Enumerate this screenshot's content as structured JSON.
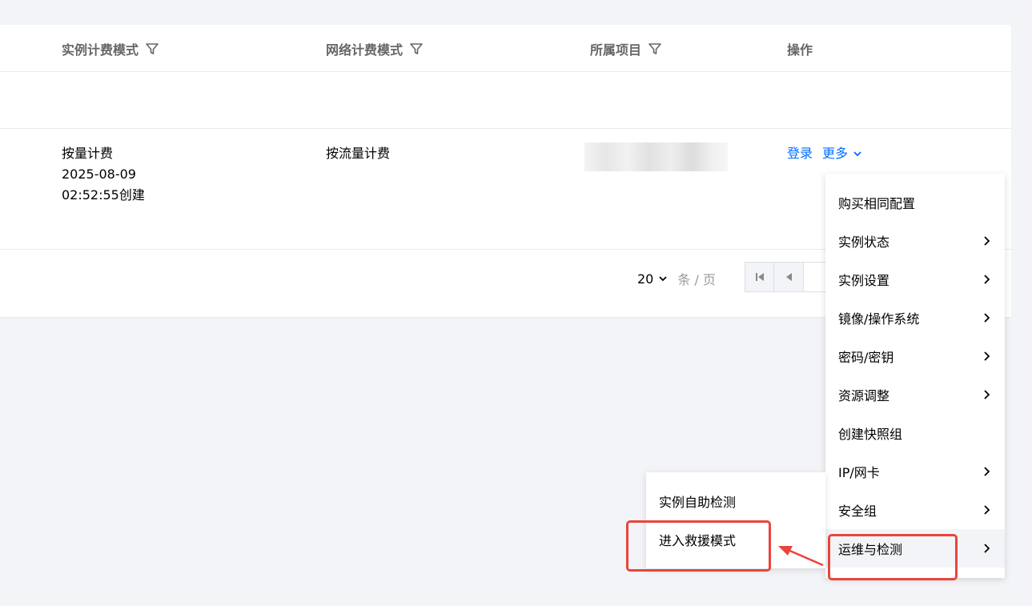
{
  "table": {
    "headers": {
      "billing_mode": "实例计费模式",
      "network_billing": "网络计费模式",
      "project": "所属项目",
      "actions": "操作"
    },
    "row": {
      "billing_mode_line1": "按量计费",
      "billing_mode_line2": "2025-08-09",
      "billing_mode_line3": "02:52:55创建",
      "network_billing": "按流量计费",
      "action_login": "登录",
      "action_more": "更多"
    }
  },
  "pager": {
    "page_size": "20",
    "unit": "条 / 页"
  },
  "menu": {
    "items": [
      {
        "label": "购买相同配置",
        "submenu": false
      },
      {
        "label": "实例状态",
        "submenu": true
      },
      {
        "label": "实例设置",
        "submenu": true
      },
      {
        "label": "镜像/操作系统",
        "submenu": true
      },
      {
        "label": "密码/密钥",
        "submenu": true
      },
      {
        "label": "资源调整",
        "submenu": true
      },
      {
        "label": "创建快照组",
        "submenu": false
      },
      {
        "label": "IP/网卡",
        "submenu": true
      },
      {
        "label": "安全组",
        "submenu": true
      },
      {
        "label": "运维与检测",
        "submenu": true
      }
    ]
  },
  "submenu": {
    "items": [
      {
        "label": "实例自助检测"
      },
      {
        "label": "进入救援模式"
      }
    ]
  },
  "colors": {
    "link": "#006eff",
    "highlight": "#e8453c"
  },
  "icons": {
    "filter": "filter-icon",
    "chevron_down": "chevron-down-icon",
    "chevron_right": "chevron-right-icon",
    "first_page": "first-page-icon",
    "prev_page": "prev-page-icon"
  }
}
